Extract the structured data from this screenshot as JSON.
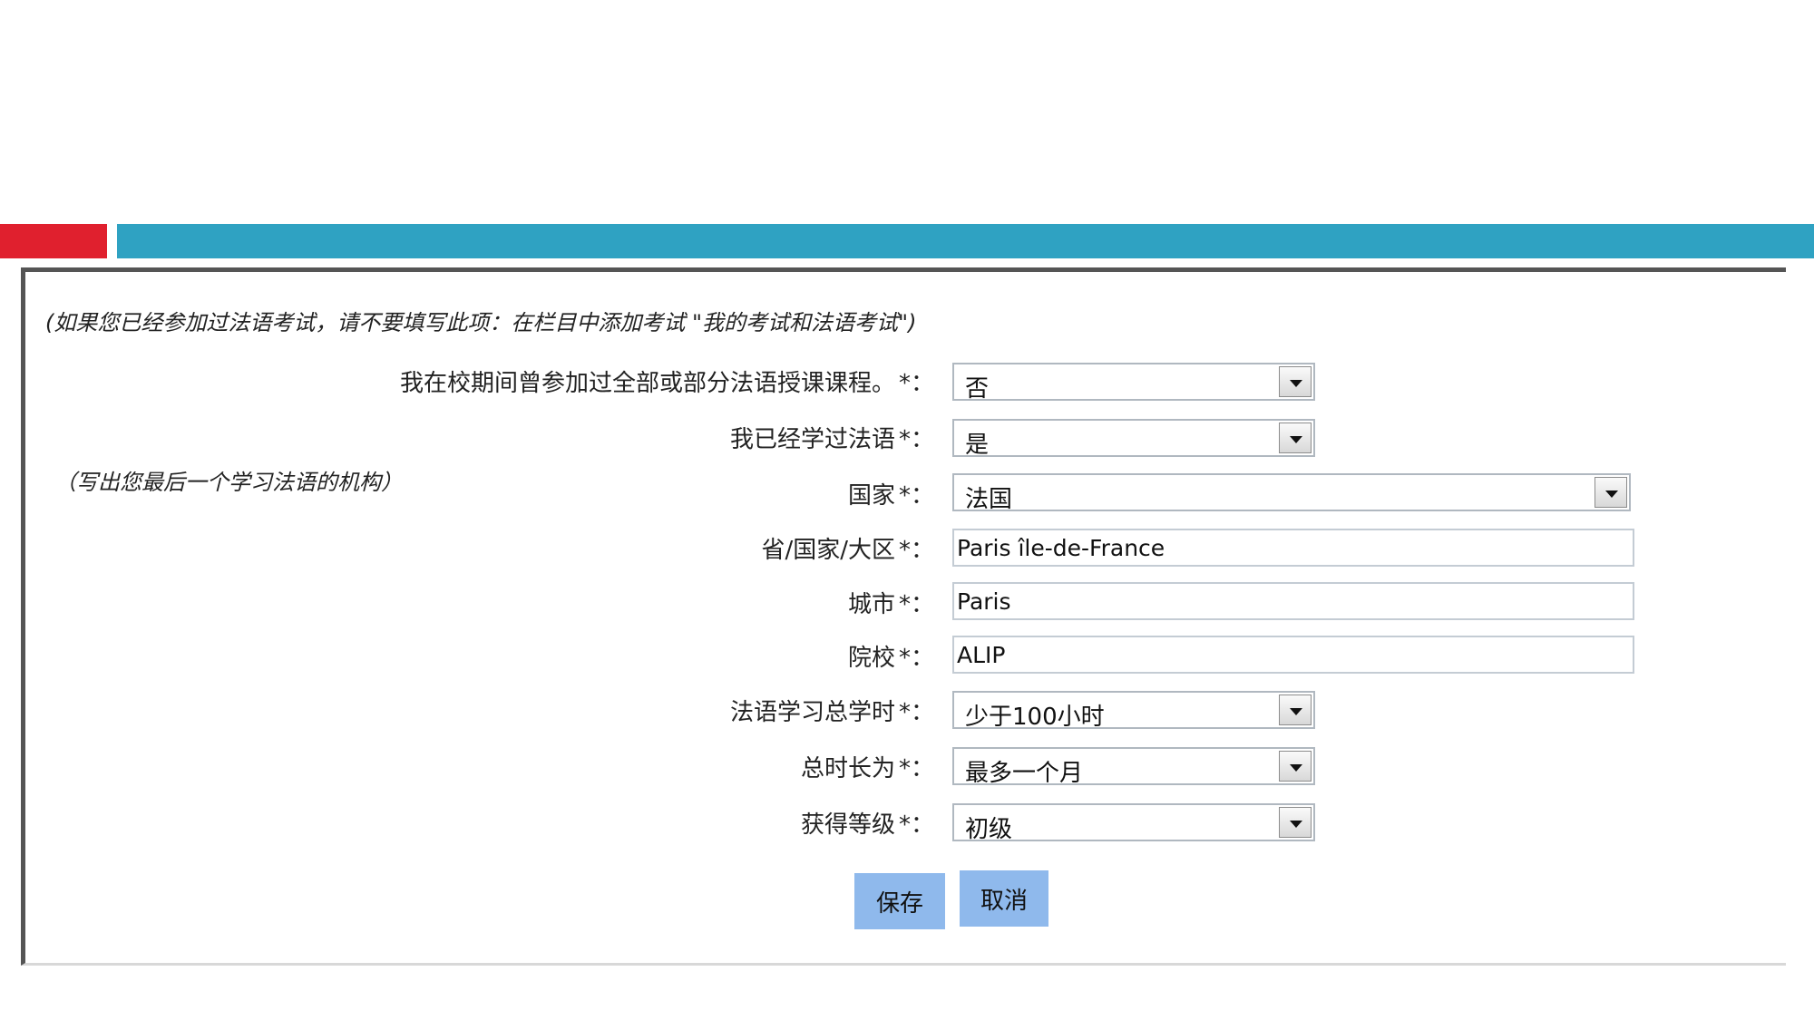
{
  "notes": {
    "exam_hint": "(如果您已经参加过法语考试，请不要填写此项：在栏目中添加考试 \"我的考试和法语考试\")",
    "institution_hint": "（写出您最后一个学习法语的机构）"
  },
  "form": {
    "required_mark": "*：",
    "fields": [
      {
        "label": "我在校期间曾参加过全部或部分法语授课课程。",
        "type": "select",
        "value": "否"
      },
      {
        "label": "我已经学过法语",
        "type": "select",
        "value": "是"
      },
      {
        "label": "国家",
        "type": "select",
        "value": "法国"
      },
      {
        "label": "省/国家/大区",
        "type": "text",
        "value": "Paris île-de-France"
      },
      {
        "label": "城市",
        "type": "text",
        "value": "Paris"
      },
      {
        "label": "院校",
        "type": "text",
        "value": "ALIP"
      },
      {
        "label": "法语学习总学时",
        "type": "select",
        "value": "少于100小时"
      },
      {
        "label": "总时长为",
        "type": "select",
        "value": "最多一个月"
      },
      {
        "label": "获得等级",
        "type": "select",
        "value": "初级"
      }
    ]
  },
  "buttons": {
    "save": "保存",
    "cancel": "取消"
  },
  "colors": {
    "accent_red": "#e0202e",
    "accent_blue": "#2fa2c2",
    "button": "#8fb9ec"
  }
}
